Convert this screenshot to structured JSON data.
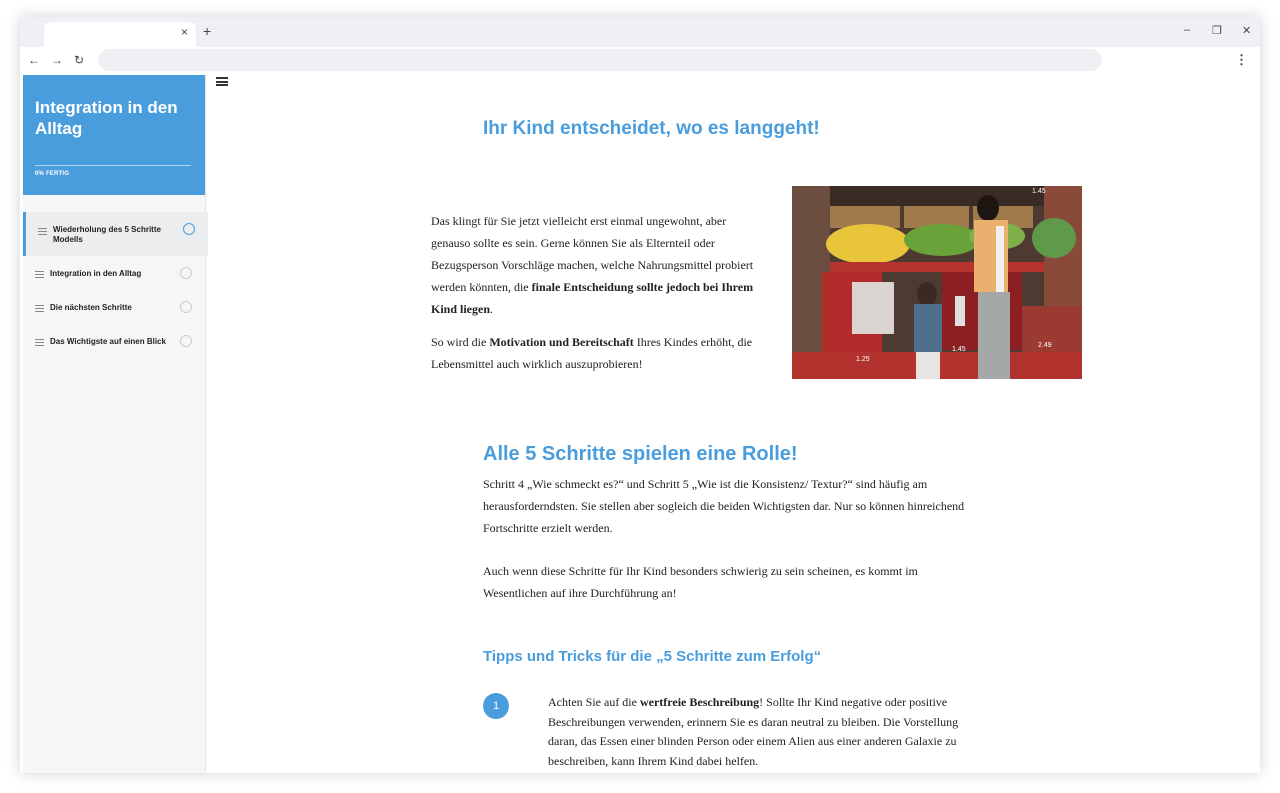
{
  "browser": {
    "tab_close": "×",
    "new_tab": "+",
    "back": "←",
    "forward": "→",
    "reload": "↻",
    "menu": "⋮",
    "minimize": "–",
    "restore": "❐",
    "close": "✕"
  },
  "sidebar": {
    "title": "Integration in den Alltag",
    "progress": "0% FERTIG",
    "items": [
      {
        "label": "Wiederholung des 5 Schritte Modells",
        "active": true
      },
      {
        "label": "Integration in den Alltag",
        "active": false
      },
      {
        "label": "Die nächsten Schritte",
        "active": false
      },
      {
        "label": "Das Wichtigste auf einen Blick",
        "active": false
      }
    ]
  },
  "content": {
    "heading1": "Ihr Kind entscheidet, wo es langgeht!",
    "para1": {
      "t1": "Das klingt für Sie jetzt vielleicht erst einmal ungewohnt, aber genauso sollte es sein. Gerne können Sie als Elternteil oder Bezugsperson Vorschläge machen, welche Nahrungsmittel probiert werden könnten, die ",
      "b1": "finale Entscheidung sollte jedoch bei Ihrem Kind liegen",
      "t2": "."
    },
    "para2": {
      "t1": "So wird die ",
      "b1": "Motivation und Bereitschaft",
      "t2": " Ihres Kindes erhöht, die Lebensmittel auch wirklich auszuprobieren!"
    },
    "photo_labels": [
      "1.25",
      "1.45",
      "1.45",
      "2.49"
    ],
    "heading2": "Alle 5 Schritte spielen eine Rolle!",
    "para3": "Schritt 4 „Wie schmeckt es?“ und Schritt 5 „Wie ist die Konsistenz/ Textur?“ sind häufig am herausforderndsten. Sie stellen aber sogleich die beiden Wichtigsten dar. Nur so können hinreichend Fortschritte erzielt werden.",
    "para4": "Auch wenn diese Schritte für Ihr Kind besonders schwierig zu sein scheinen, es kommt im Wesentlichen auf ihre Durchführung an!",
    "heading3": "Tipps und Tricks für die „5 Schritte zum Erfolg“",
    "tip_number": "1",
    "tip1": {
      "t1": "Achten Sie auf die ",
      "b1": "wertfreie Beschreibung",
      "t2": "! Sollte Ihr Kind negative oder positive Beschreibungen verwenden, erinnern Sie es daran neutral zu bleiben. Die Vorstellung daran, das Essen einer blinden Person oder einem Alien aus einer anderen Galaxie zu beschreiben, kann Ihrem Kind dabei helfen."
    }
  },
  "colors": {
    "accent": "#4a9ddd"
  }
}
